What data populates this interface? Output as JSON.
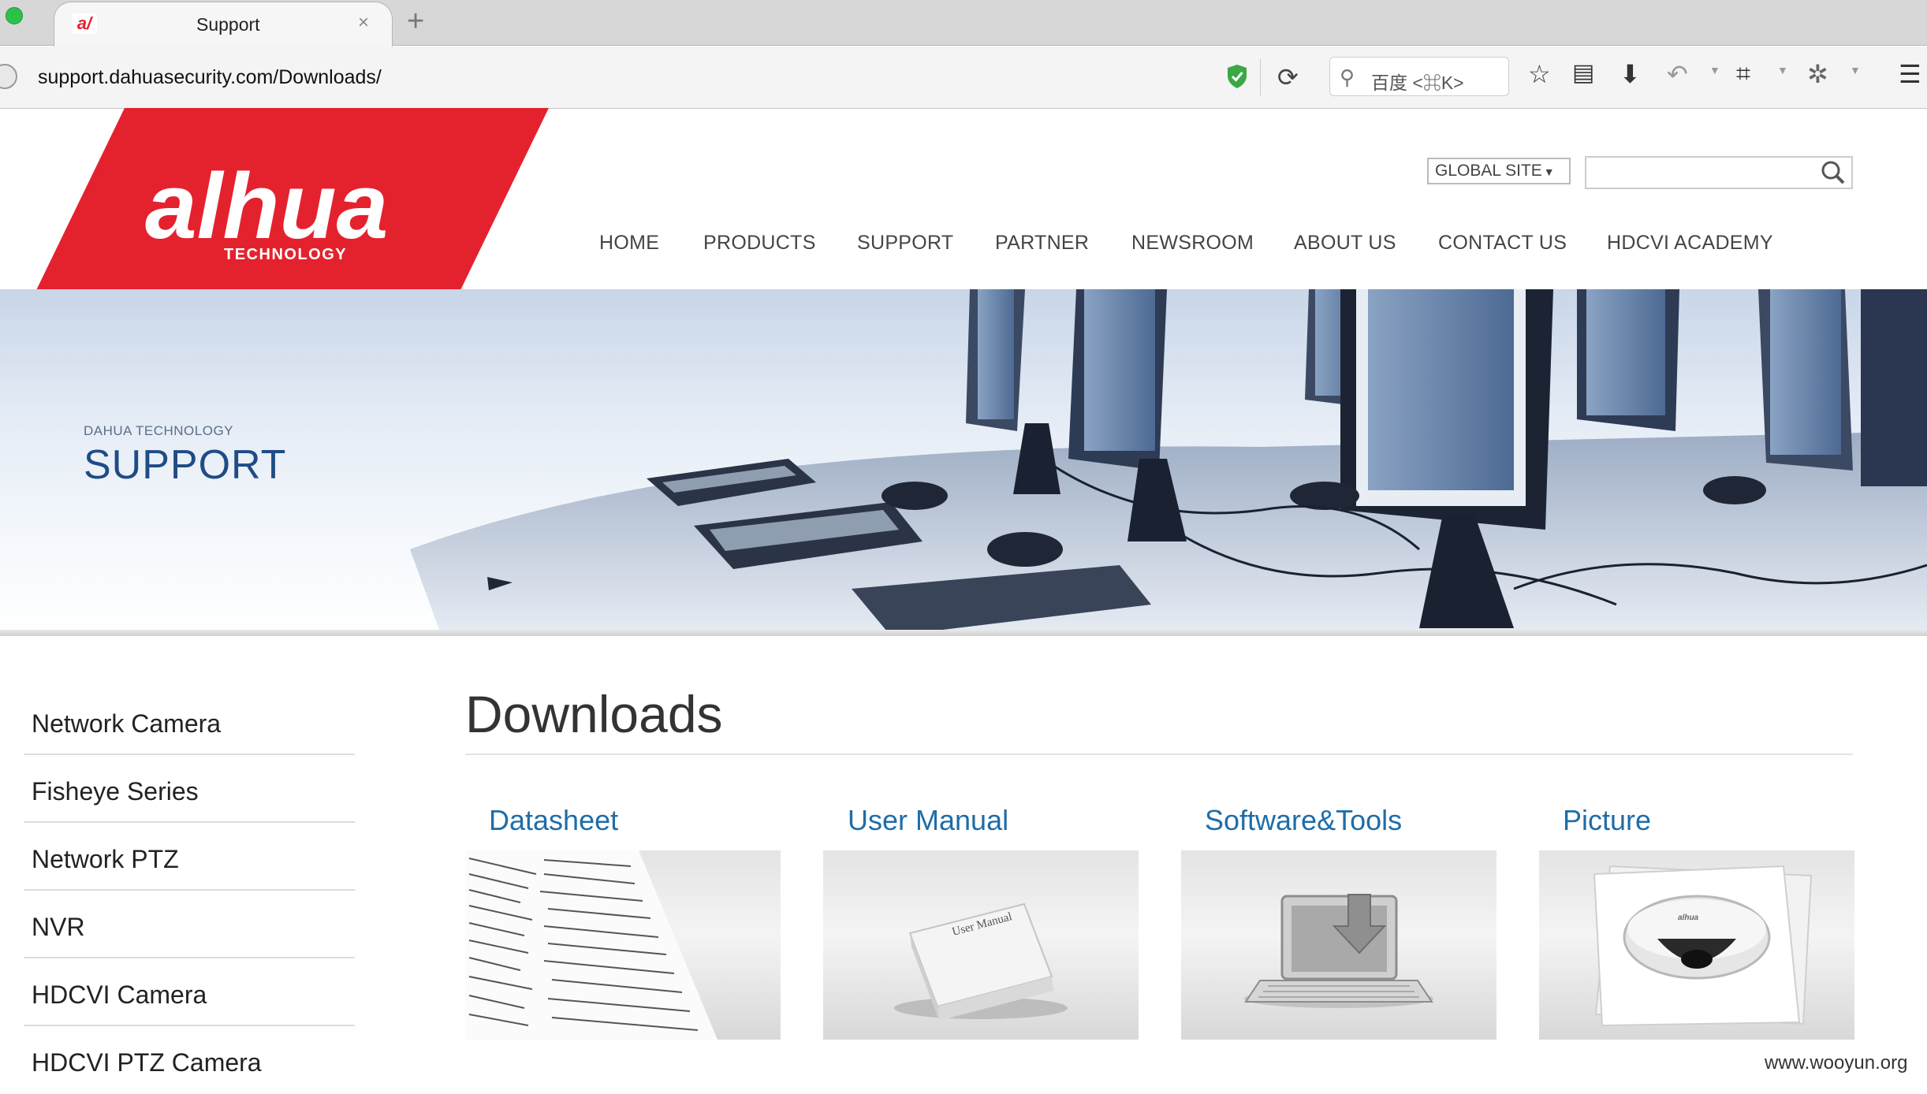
{
  "browser": {
    "tab_title": "Support",
    "tab_close": "×",
    "new_tab": "+",
    "url": "support.dahuasecurity.com/Downloads/",
    "search_placeholder": "百度 <⌘K>"
  },
  "site": {
    "logo_text": "alhua",
    "logo_subtext": "TECHNOLOGY",
    "global_site": "GLOBAL SITE",
    "nav": [
      "HOME",
      "PRODUCTS",
      "SUPPORT",
      "PARTNER",
      "NEWSROOM",
      "ABOUT US",
      "CONTACT US",
      "HDCVI ACADEMY"
    ],
    "colors": {
      "brand_red": "#e4222e",
      "link_blue": "#1e6da8",
      "banner_title": "#1f4c86"
    }
  },
  "banner": {
    "subtitle": "DAHUA TECHNOLOGY",
    "title": "SUPPORT"
  },
  "sidebar": {
    "items": [
      "Network Camera",
      "Fisheye Series",
      "Network PTZ",
      "NVR",
      "HDCVI Camera",
      "HDCVI PTZ Camera"
    ]
  },
  "main": {
    "title": "Downloads",
    "categories": [
      "Datasheet",
      "User Manual",
      "Software&Tools",
      "Picture"
    ],
    "manual_cover_text": "User Manual",
    "picture_brand": "alhua"
  },
  "footer": {
    "watermark": "www.wooyun.org"
  }
}
